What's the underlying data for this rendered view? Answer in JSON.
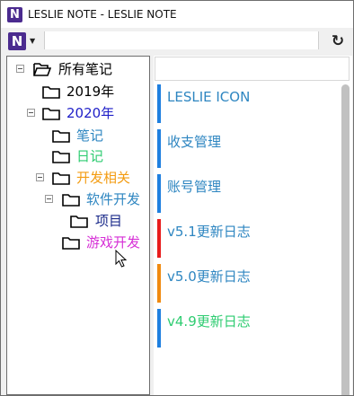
{
  "window": {
    "title": "LESLIE NOTE - LESLIE NOTE",
    "app_icon_letter": "N"
  },
  "toolbar": {
    "logo_letter": "N",
    "address_value": "",
    "refresh_icon": "refresh-icon",
    "dropdown_icon": "chevron-down-icon"
  },
  "tree": {
    "items": [
      {
        "label": "所有笔记",
        "color": "#000000",
        "icon": "folder-open-icon",
        "expanded": true
      },
      {
        "label": "2019年",
        "color": "#000000",
        "icon": "folder-icon"
      },
      {
        "label": "2020年",
        "color": "#1f1fc8",
        "icon": "folder-icon",
        "expanded": true
      },
      {
        "label": "笔记",
        "color": "#2e86c1",
        "icon": "folder-icon"
      },
      {
        "label": "日记",
        "color": "#2ecc71",
        "icon": "folder-icon"
      },
      {
        "label": "开发相关",
        "color": "#f39c12",
        "icon": "folder-icon",
        "expanded": true
      },
      {
        "label": "软件开发",
        "color": "#2e86c1",
        "icon": "folder-icon",
        "expanded": true
      },
      {
        "label": "项目",
        "color": "#1a2a8a",
        "icon": "folder-icon"
      },
      {
        "label": "游戏开发",
        "color": "#d62fd6",
        "icon": "folder-icon"
      }
    ]
  },
  "notes": {
    "search_value": "",
    "items": [
      {
        "title": "LESLIE ICON",
        "color": "#2e86c1",
        "bar_color": "#1e7fe0"
      },
      {
        "title": "收支管理",
        "color": "#2e86c1",
        "bar_color": "#1e7fe0"
      },
      {
        "title": "账号管理",
        "color": "#2e86c1",
        "bar_color": "#1e7fe0"
      },
      {
        "title": "v5.1更新日志",
        "color": "#2e86c1",
        "bar_color": "#e81c1c"
      },
      {
        "title": "v5.0更新日志",
        "color": "#2e86c1",
        "bar_color": "#f08a10"
      },
      {
        "title": "v4.9更新日志",
        "color": "#2ecc71",
        "bar_color": "#1e7fe0"
      }
    ]
  }
}
